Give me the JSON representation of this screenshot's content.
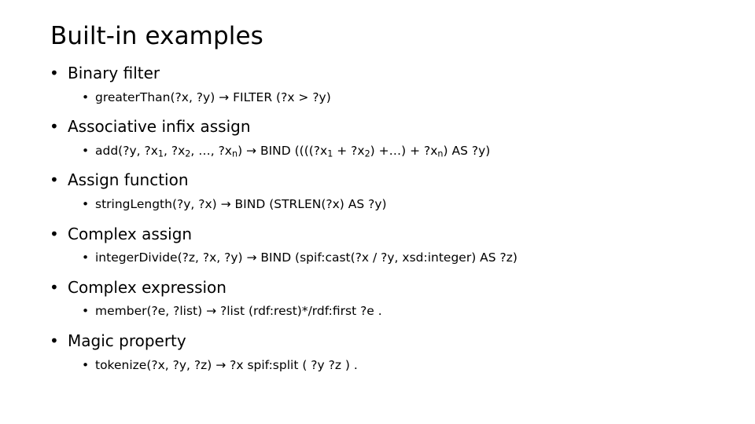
{
  "slide": {
    "title": "Built-in examples",
    "bullet_glyph": "•",
    "arrow_glyph": "→",
    "text_color": "#000000",
    "background_color": "#ffffff",
    "groups": [
      {
        "heading": "Binary filter",
        "detail_plain": "greaterThan(?x, ?y) → FILTER (?x > ?y)",
        "detail_parts": [
          {
            "text": "greaterThan(?x, ?y) → FILTER (?x > ?y)"
          }
        ]
      },
      {
        "heading": "Associative infix assign",
        "detail_plain": "add(?y, ?x1, ?x2, …, ?xn) → BIND ((((?x1 + ?x2) +…) + ?xn) AS ?y)",
        "detail_parts": [
          {
            "text": "add(?y, ?x"
          },
          {
            "text": "1",
            "sub": true
          },
          {
            "text": ", ?x"
          },
          {
            "text": "2",
            "sub": true
          },
          {
            "text": ", …, ?x"
          },
          {
            "text": "n",
            "sub": true
          },
          {
            "text": ") → BIND ((((?x"
          },
          {
            "text": "1",
            "sub": true
          },
          {
            "text": " + ?x"
          },
          {
            "text": "2",
            "sub": true
          },
          {
            "text": ") +…) + ?x"
          },
          {
            "text": "n",
            "sub": true
          },
          {
            "text": ") AS ?y)"
          }
        ]
      },
      {
        "heading": "Assign function",
        "detail_plain": "stringLength(?y, ?x) → BIND (STRLEN(?x) AS ?y)",
        "detail_parts": [
          {
            "text": "stringLength(?y, ?x) → BIND (STRLEN(?x) AS ?y)"
          }
        ]
      },
      {
        "heading": "Complex assign",
        "detail_plain": "integerDivide(?z, ?x, ?y) → BIND (spif:cast(?x / ?y, xsd:integer) AS ?z)",
        "detail_parts": [
          {
            "text": "integerDivide(?z, ?x, ?y) → BIND (spif:cast(?x / ?y, xsd:integer) AS ?z)"
          }
        ]
      },
      {
        "heading": "Complex expression",
        "detail_plain": "member(?e, ?list) → ?list (rdf:rest)*/rdf:first ?e .",
        "detail_parts": [
          {
            "text": "member(?e, ?list) → ?list (rdf:rest)*/rdf:first ?e ."
          }
        ]
      },
      {
        "heading": "Magic property",
        "detail_plain": "tokenize(?x, ?y, ?z) → ?x spif:split ( ?y ?z ) .",
        "detail_parts": [
          {
            "text": "tokenize(?x, ?y, ?z) → ?x spif:split ( ?y ?z ) ."
          }
        ]
      }
    ]
  }
}
